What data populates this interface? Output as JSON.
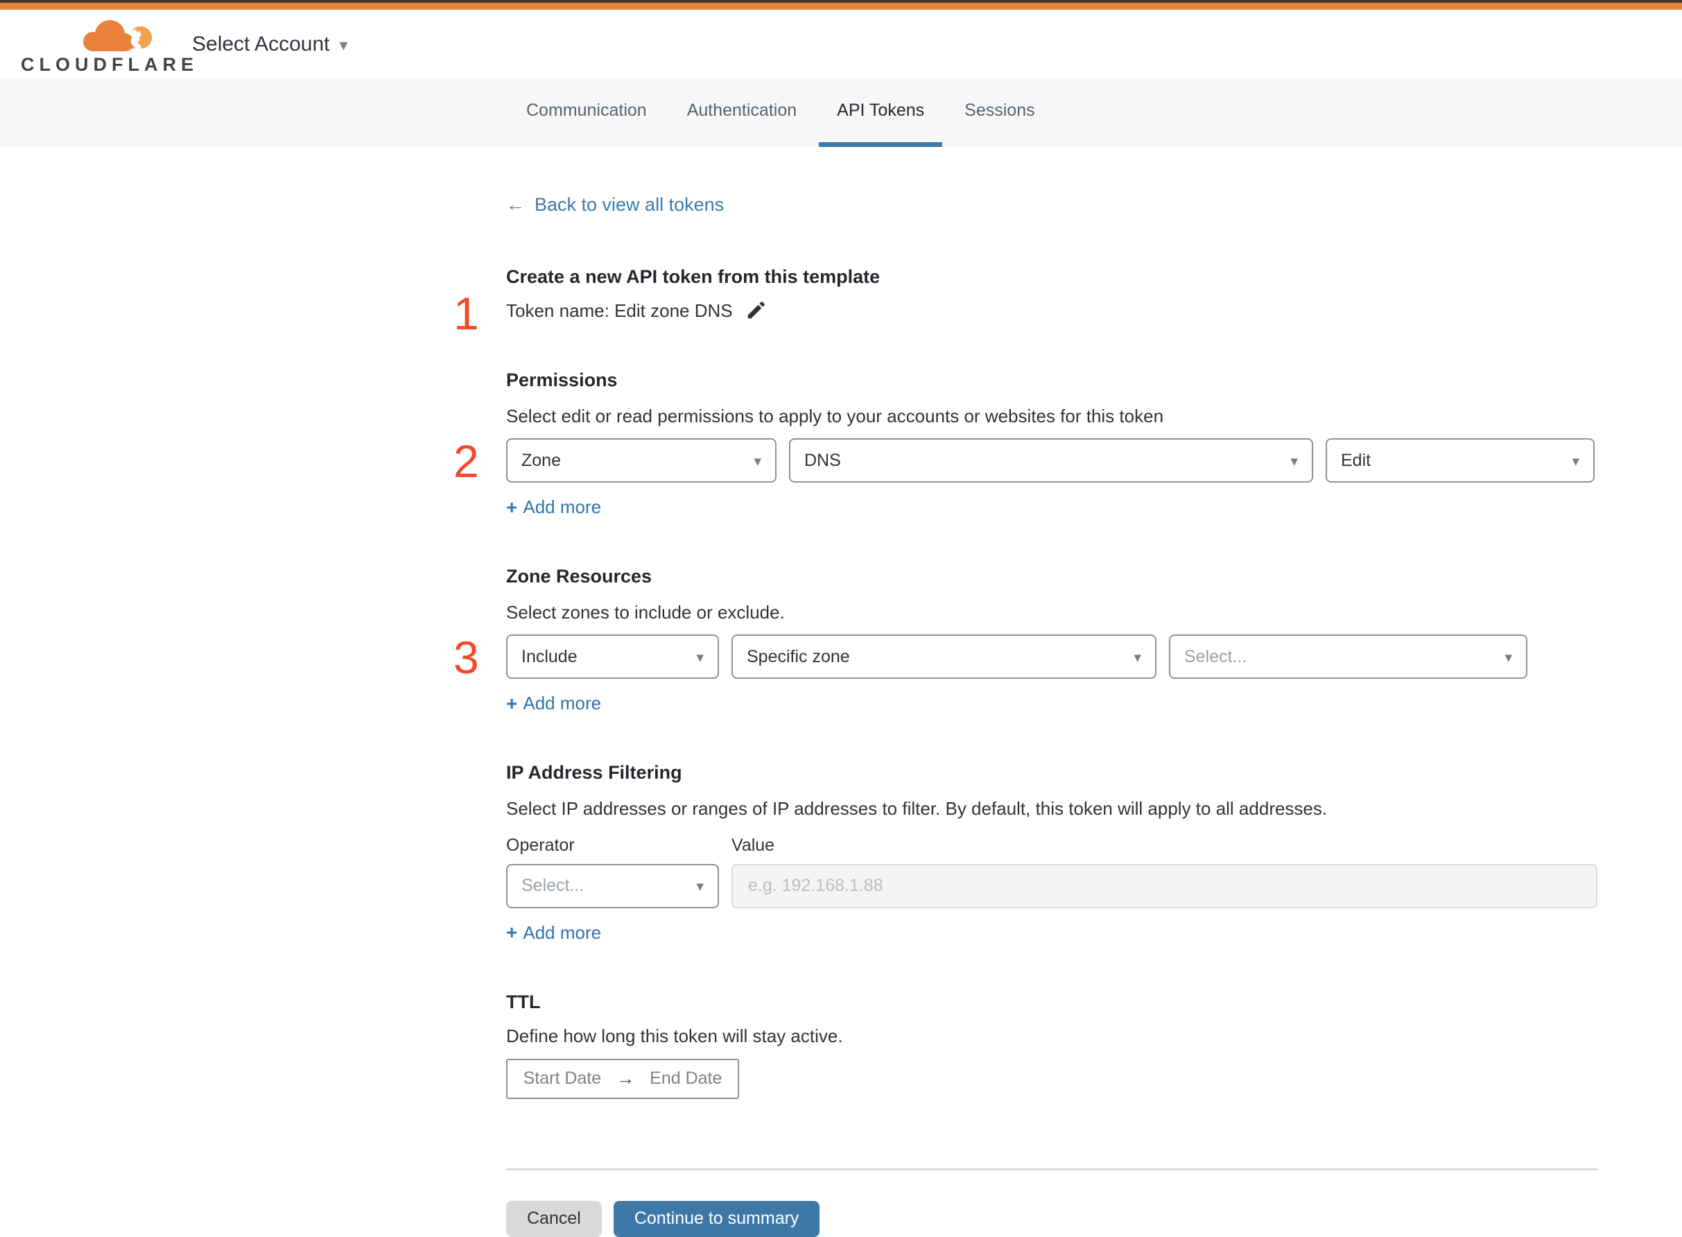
{
  "header": {
    "brand": "CLOUDFLARE",
    "account_selector": "Select Account"
  },
  "tabs": {
    "items": [
      {
        "label": "Communication"
      },
      {
        "label": "Authentication"
      },
      {
        "label": "API Tokens"
      },
      {
        "label": "Sessions"
      }
    ],
    "active": "API Tokens"
  },
  "back_link": {
    "label": "Back to view all tokens"
  },
  "template_section": {
    "step": "1",
    "title": "Create a new API token from this template",
    "token_name": "Token name: Edit zone DNS"
  },
  "permissions": {
    "step": "2",
    "title": "Permissions",
    "description": "Select edit or read permissions to apply to your accounts or websites for this token",
    "scope": "Zone",
    "resource": "DNS",
    "access": "Edit",
    "add_more_label": "Add more"
  },
  "zone_resources": {
    "step": "3",
    "title": "Zone Resources",
    "description": "Select zones to include or exclude.",
    "mode": "Include",
    "zone_type": "Specific zone",
    "zone_placeholder": "Select...",
    "add_more_label": "Add more"
  },
  "ip_filtering": {
    "title": "IP Address Filtering",
    "description": "Select IP addresses or ranges of IP addresses to filter. By default, this token will apply to all addresses.",
    "operator_label": "Operator",
    "value_label": "Value",
    "operator_placeholder": "Select...",
    "value_placeholder": "e.g. 192.168.1.88",
    "add_more_label": "Add more"
  },
  "ttl": {
    "title": "TTL",
    "description": "Define how long this token will stay active.",
    "start_placeholder": "Start Date",
    "end_placeholder": "End Date"
  },
  "footer": {
    "cancel_label": "Cancel",
    "continue_label": "Continue to summary"
  },
  "icons": {
    "back_arrow": "←",
    "caret_down": "▾",
    "plus": "+",
    "range_arrow": "→"
  },
  "colors": {
    "topbar_orange": "#e08437",
    "topbar_dark": "#3f352b",
    "step_number_red": "#f2492b",
    "link_blue": "#3d79b0",
    "active_tab_underline": "#417aa9",
    "continue_button_blue": "#3d78a9",
    "cancel_button_gray": "#d9d9d9"
  }
}
